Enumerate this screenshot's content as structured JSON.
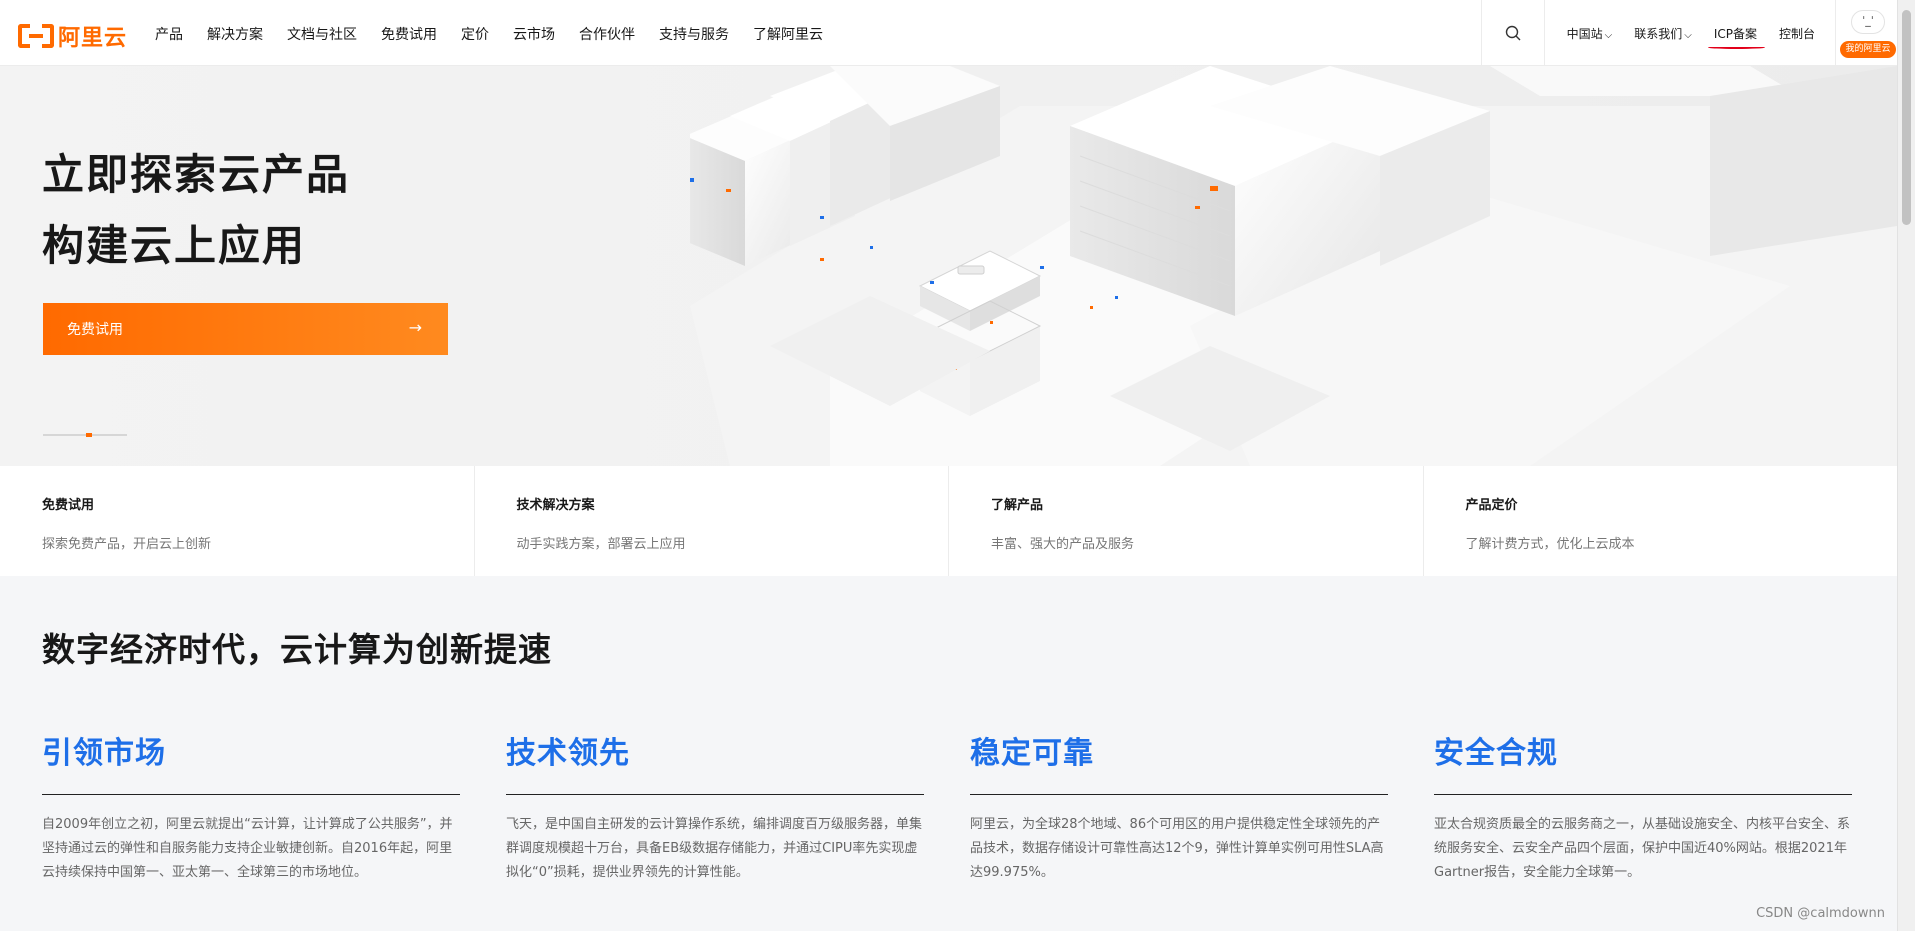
{
  "logo": {
    "text": "阿里云"
  },
  "menu": [
    "产品",
    "解决方案",
    "文档与社区",
    "免费试用",
    "定价",
    "云市场",
    "合作伙伴",
    "支持与服务",
    "了解阿里云"
  ],
  "nav_right": {
    "region": "中国站",
    "contact": "联系我们",
    "icp": "ICP备案",
    "console": "控制台",
    "account_badge": "我的阿里云"
  },
  "hero": {
    "title_line1": "立即探索云产品",
    "title_line2": "构建云上应用",
    "cta_label": "免费试用",
    "cta_arrow": "→"
  },
  "quick_cards": [
    {
      "title": "免费试用",
      "desc": "探索免费产品，开启云上创新"
    },
    {
      "title": "技术解决方案",
      "desc": "动手实践方案，部署云上应用"
    },
    {
      "title": "了解产品",
      "desc": "丰富、强大的产品及服务"
    },
    {
      "title": "产品定价",
      "desc": "了解计费方式，优化上云成本"
    }
  ],
  "section": {
    "title": "数字经济时代，云计算为创新提速"
  },
  "features": [
    {
      "title": "引领市场",
      "desc": "自2009年创立之初，阿里云就提出“云计算，让计算成了公共服务”，并坚持通过云的弹性和自服务能力支持企业敏捷创新。自2016年起，阿里云持续保持中国第一、亚太第一、全球第三的市场地位。"
    },
    {
      "title": "技术领先",
      "desc": "飞天，是中国自主研发的云计算操作系统，编排调度百万级服务器，单集群调度规模超十万台，具备EB级数据存储能力，并通过CIPU率先实现虚拟化“0”损耗，提供业界领先的计算性能。"
    },
    {
      "title": "稳定可靠",
      "desc": "阿里云，为全球28个地域、86个可用区的用户提供稳定性全球领先的产品技术，数据存储设计可靠性高达12个9，弹性计算单实例可用性SLA高达99.975%。"
    },
    {
      "title": "安全合规",
      "desc": "亚太合规资质最全的云服务商之一，从基础设施安全、内核平台安全、系统服务安全、云安全产品四个层面，保护中国近40%网站。根据2021年Gartner报告，安全能力全球第一。"
    }
  ],
  "watermark": "CSDN @calmdownn",
  "colors": {
    "brand": "#ff6a00",
    "feature_blue": "#1e6fe8",
    "icp_mark": "#e2001a"
  }
}
